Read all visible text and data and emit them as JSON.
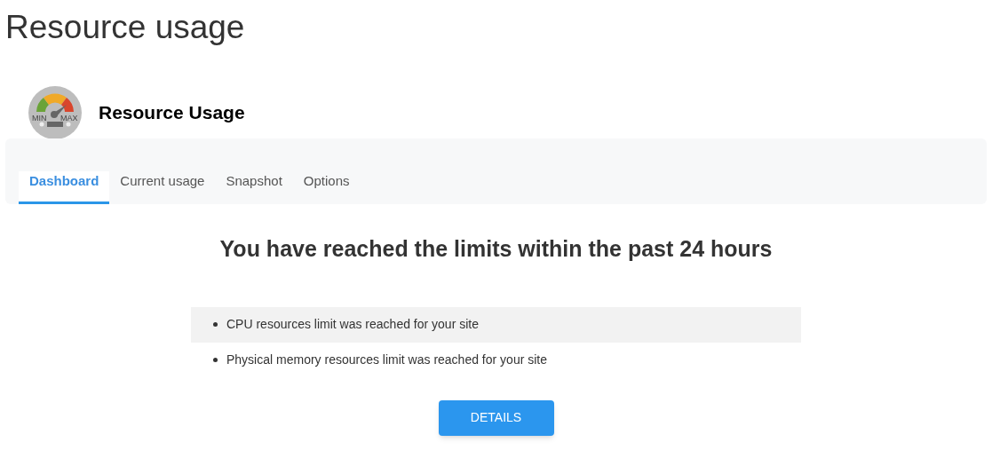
{
  "page_title": "Resource usage",
  "plugin": {
    "name": "Resource Usage",
    "logo_labels": [
      "MIN",
      "MAX"
    ]
  },
  "tabs": [
    {
      "label": "Dashboard",
      "selected": true
    },
    {
      "label": "Current usage",
      "selected": false
    },
    {
      "label": "Snapshot",
      "selected": false
    },
    {
      "label": "Options",
      "selected": false
    }
  ],
  "heading": "You have reached the limits within the past 24 hours",
  "alerts": [
    {
      "text": "CPU resources limit was reached for your site",
      "shaded": true
    },
    {
      "text": "Physical memory resources limit was reached for your site",
      "shaded": false
    }
  ],
  "button": "DETAILS"
}
